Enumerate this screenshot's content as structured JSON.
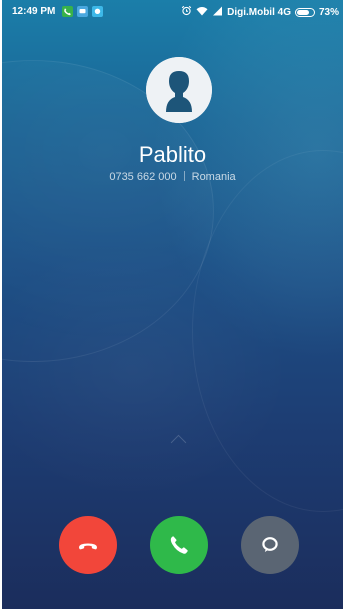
{
  "status_bar": {
    "time": "12:49 PM",
    "carrier": "Digi.Mobil 4G",
    "battery_percent": "73%",
    "battery_level": 0.73,
    "icons": [
      "phone-notification-icon",
      "message-notification-icon",
      "message-notification-icon",
      "alarm-icon",
      "wifi-icon",
      "signal-icon",
      "battery-icon"
    ]
  },
  "caller": {
    "name": "Pablito",
    "number": "0735 662 000",
    "location": "Romania"
  },
  "actions": {
    "decline": "end-call-icon",
    "answer": "phone-icon",
    "message": "message-bubble-icon"
  },
  "colors": {
    "decline": "#f2463a",
    "answer": "#2fb94a",
    "message": "#5a6573",
    "background_top": "#1b7ea9",
    "background_bottom": "#1b2d5c"
  }
}
